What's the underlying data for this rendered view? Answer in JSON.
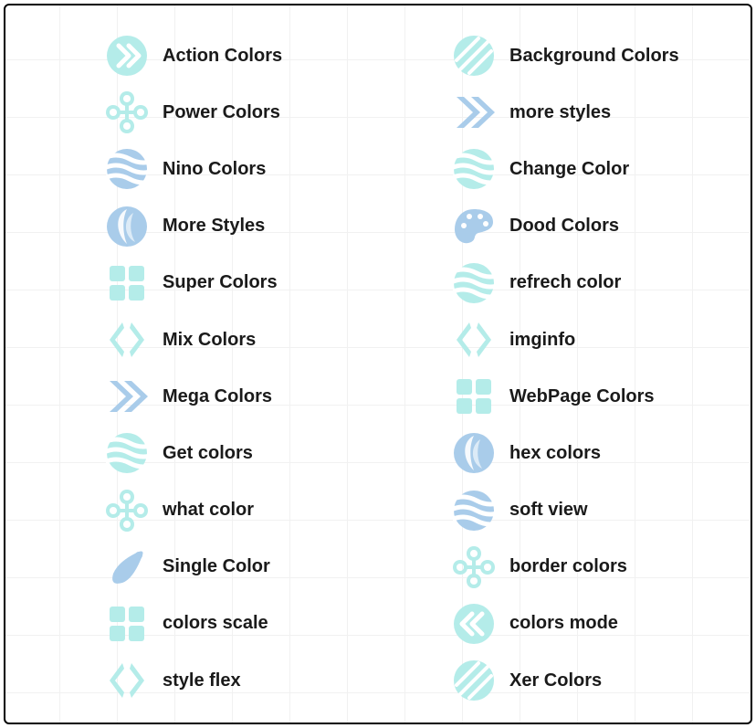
{
  "colors": {
    "teal": "#b4ece9",
    "blue": "#a9ccea"
  },
  "columns": [
    {
      "items": [
        {
          "label": "Action Colors",
          "icon": "chevrons-circle",
          "tint": "teal"
        },
        {
          "label": "Power Colors",
          "icon": "cross-loops",
          "tint": "teal"
        },
        {
          "label": "Nino Colors",
          "icon": "wave-sphere",
          "tint": "blue"
        },
        {
          "label": "More Styles",
          "icon": "swirl-leaf",
          "tint": "blue"
        },
        {
          "label": "Super Colors",
          "icon": "quad-tiles",
          "tint": "teal"
        },
        {
          "label": "Mix Colors",
          "icon": "angle-pair",
          "tint": "teal"
        },
        {
          "label": "Mega Colors",
          "icon": "chevrons-solid",
          "tint": "blue"
        },
        {
          "label": "Get colors",
          "icon": "wave-sphere",
          "tint": "teal"
        },
        {
          "label": "what color",
          "icon": "cross-loops",
          "tint": "teal"
        },
        {
          "label": "Single Color",
          "icon": "brush-dot",
          "tint": "blue"
        },
        {
          "label": "colors scale",
          "icon": "quad-tiles",
          "tint": "teal"
        },
        {
          "label": "style flex",
          "icon": "angle-pair",
          "tint": "teal"
        }
      ]
    },
    {
      "items": [
        {
          "label": "Background Colors",
          "icon": "hatched-sphere",
          "tint": "teal"
        },
        {
          "label": "more styles",
          "icon": "chevrons-solid",
          "tint": "blue"
        },
        {
          "label": "Change Color",
          "icon": "wave-sphere",
          "tint": "teal"
        },
        {
          "label": "Dood Colors",
          "icon": "palette",
          "tint": "blue"
        },
        {
          "label": "refrech color",
          "icon": "wave-sphere",
          "tint": "teal"
        },
        {
          "label": "imginfo",
          "icon": "angle-pair",
          "tint": "teal"
        },
        {
          "label": "WebPage Colors",
          "icon": "quad-tiles",
          "tint": "teal"
        },
        {
          "label": "hex colors",
          "icon": "swirl-leaf",
          "tint": "blue"
        },
        {
          "label": "soft view",
          "icon": "wave-sphere",
          "tint": "blue"
        },
        {
          "label": "border colors",
          "icon": "cross-loops",
          "tint": "teal"
        },
        {
          "label": "colors mode",
          "icon": "chevrons-left",
          "tint": "teal"
        },
        {
          "label": "Xer Colors",
          "icon": "hatched-sphere",
          "tint": "teal"
        }
      ]
    }
  ]
}
